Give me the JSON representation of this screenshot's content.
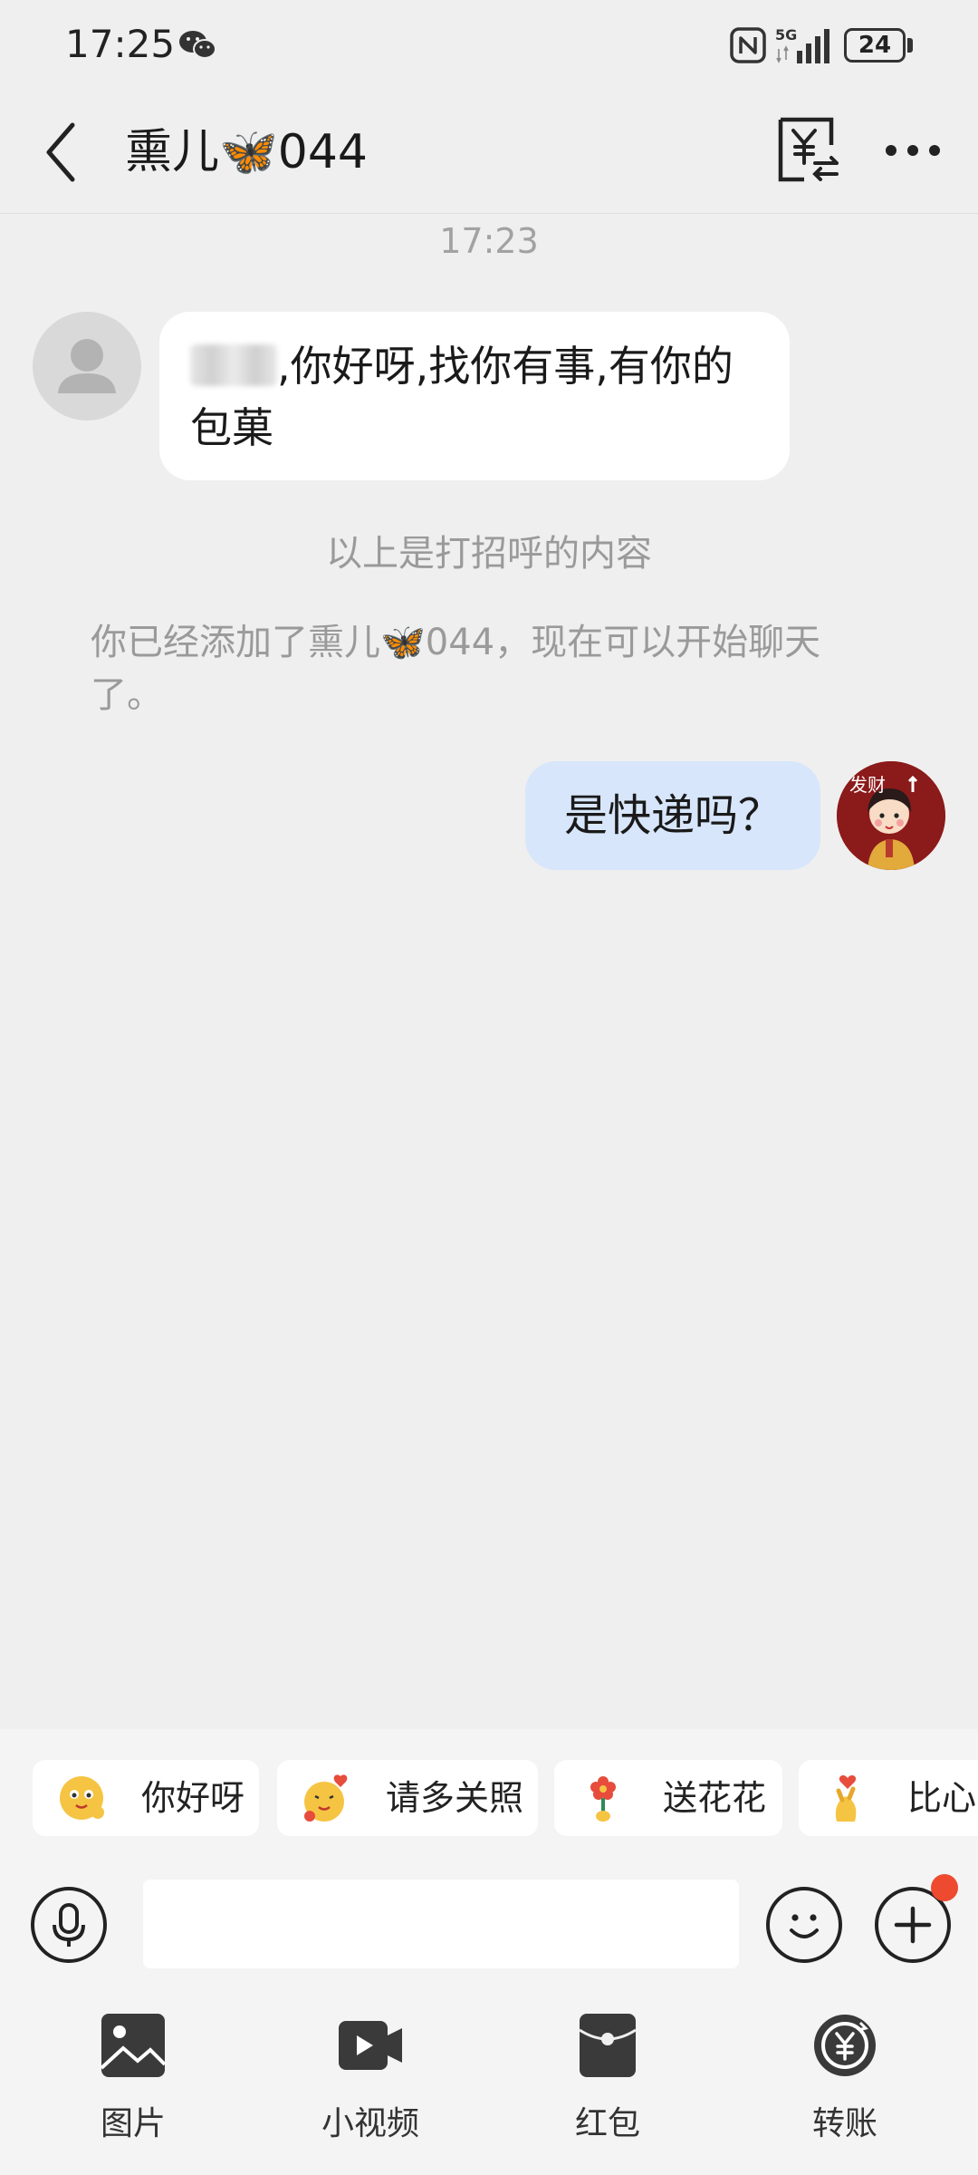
{
  "status_bar": {
    "time": "17:25",
    "network": "5G",
    "battery": "24"
  },
  "header": {
    "title": "熏儿🦋044"
  },
  "chat": {
    "timestamp": "17:23",
    "incoming": {
      "text": ",你好呀,找你有事,有你的包菓"
    },
    "greeting_note": "以上是打招呼的内容",
    "added_note": "你已经添加了熏儿🦋044，现在可以开始聊天了。",
    "outgoing": {
      "text": "是快递吗？"
    },
    "outgoing_avatar_caption": "发财"
  },
  "quick_replies": [
    {
      "label": "你好呀",
      "emoji": "smile-emoji-icon"
    },
    {
      "label": "请多关照",
      "emoji": "hug-emoji-icon"
    },
    {
      "label": "送花花",
      "emoji": "flower-emoji-icon"
    },
    {
      "label": "比心",
      "emoji": "heart-hand-emoji-icon"
    }
  ],
  "input": {
    "placeholder": "",
    "value": ""
  },
  "tools": [
    {
      "label": "图片",
      "icon": "image-icon"
    },
    {
      "label": "小视频",
      "icon": "video-icon"
    },
    {
      "label": "红包",
      "icon": "red-packet-icon"
    },
    {
      "label": "转账",
      "icon": "transfer-icon"
    }
  ],
  "colors": {
    "background": "#efefef",
    "outgoing_bubble": "#d7e6fb",
    "incoming_bubble": "#ffffff",
    "notification": "#ee4a2f",
    "muted_text": "#9a9a9a"
  }
}
